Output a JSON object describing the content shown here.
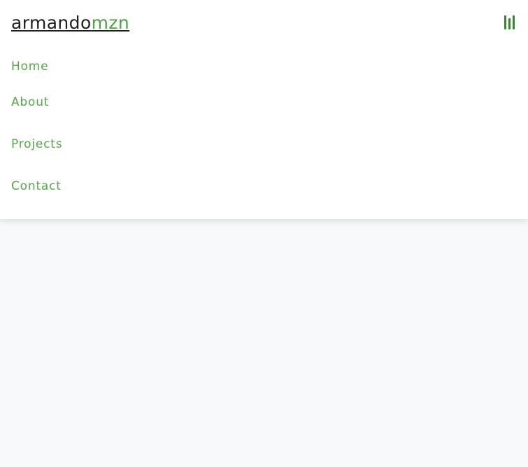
{
  "header": {
    "brand_primary": "armando",
    "brand_accent": "mzn",
    "menu_toggle_icon": "menu-toggle-icon"
  },
  "navigation": {
    "items": [
      {
        "label": "Home"
      },
      {
        "label": "About"
      },
      {
        "label": "Projects"
      },
      {
        "label": "Contact"
      }
    ]
  },
  "colors": {
    "brand_text": "#1f1f1f",
    "brand_accent": "#49a53d",
    "menu_link": "#56a84a",
    "page_background": "#f8f9fa",
    "panel_background": "#ffffff"
  }
}
